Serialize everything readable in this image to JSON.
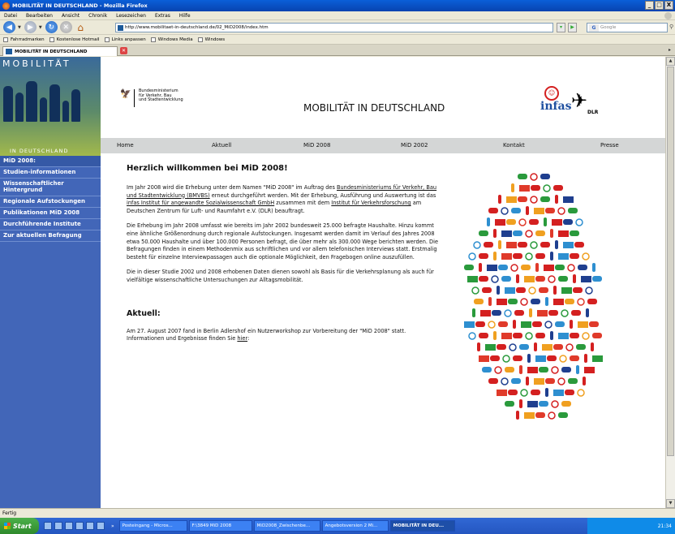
{
  "window": {
    "title": "MOBILITÄT IN DEUTSCHLAND - Mozilla Firefox",
    "buttons": [
      "_",
      "□",
      "X"
    ]
  },
  "menu": [
    "Datei",
    "Bearbeiten",
    "Ansicht",
    "Chronik",
    "Lesezeichen",
    "Extras",
    "Hilfe"
  ],
  "address": {
    "url": "http://www.mobilitaet-in-deutschland.de/02_MiD2008/index.htm",
    "search_placeholder": "Google"
  },
  "bookmarks": [
    "Fahrradmarken",
    "Kostenlose Hotmail",
    "Links anpassen",
    "Windows Media",
    "Windows"
  ],
  "tab": {
    "label": "MOBILITÄT IN DEUTSCHLAND"
  },
  "sidebar": {
    "logo_top": "MOBILITÄT",
    "logo_bottom": "IN DEUTSCHLAND",
    "items": [
      "MiD 2008:",
      "Studien-informationen",
      "Wissenschaftlicher Hintergrund",
      "Regionale Aufstockungen",
      "Publikationen MiD 2008",
      "Durchführende Institute",
      "Zur aktuellen Befragung"
    ]
  },
  "header": {
    "ministry_lines": [
      "Bundesministerium",
      "für Verkehr, Bau",
      "und Stadtentwicklung"
    ],
    "site_title": "MOBILITÄT IN DEUTSCHLAND",
    "infas": "infas",
    "dlr": "DLR"
  },
  "topnav": [
    "Home",
    "Aktuell",
    "MiD 2008",
    "MiD 2002",
    "Kontakt",
    "Presse"
  ],
  "main": {
    "heading": "Herzlich willkommen bei MiD 2008!",
    "p1_a": "Im Jahr 2008 wird die Erhebung unter dem Namen \"MiD 2008\" im Auftrag des ",
    "p1_link1": "Bundesministeriums für Verkehr, Bau und Stadtentwicklung (BMVBS)",
    "p1_b": " erneut durchgeführt werden. Mit der Erhebung, Ausführung und Auswertung ist das ",
    "p1_link2": "infas Institut für angewandte Sozialwissenschaft GmbH",
    "p1_c": " zusammen mit dem ",
    "p1_link3": "Institut für Verkehrsforschung",
    "p1_d": " am Deutschen Zentrum für Luft- und Raumfahrt e.V. (DLR) beauftragt.",
    "p2": "Die Erhebung im Jahr 2008 umfasst wie bereits im Jahr 2002 bundesweit 25.000 befragte Haushalte. Hinzu kommt eine ähnliche Größenordnung durch regionale Aufstockungen. Insgesamt werden damit im Verlauf des Jahres 2008 etwa 50.000 Haushalte und über 100.000 Personen befragt, die über mehr als 300.000 Wege berichten werden. Die Befragungen finden in einem Methodenmix aus schriftlichen und vor allem telefonischen Interviews statt. Erstmalig besteht für einzelne Interviewpassagen auch die optionale Möglichkeit, den Fragebogen online auszufüllen.",
    "p3": "Die in dieser Studie 2002 und 2008 erhobenen Daten dienen sowohl als Basis für die Verkehrsplanung als auch für vielfältige wissenschaftliche Untersuchungen zur Alltagsmobilität.",
    "heading2": "Aktuell:",
    "p4_a": "Am 27. August 2007 fand in Berlin Adlershof ein Nutzerworkshop zur Vorbereitung der \"MiD 2008\" statt. Informationen und Ergebnisse finden Sie ",
    "p4_link": "hier",
    "p4_b": ":"
  },
  "status": "Fertig",
  "taskbar": {
    "start": "Start",
    "buttons": [
      "»",
      "Posteingang - Micros...",
      "F:\\3849 MiD 2008",
      "MiD2008_Zwischenbe...",
      "Angebotsversion 2 Mi...",
      "MOBILITÄT IN DEU..."
    ],
    "clock": "21:34"
  },
  "colors": {
    "sidebar": "#4266b8",
    "topnav": "#d4d6d6",
    "accent_red": "#d42020"
  }
}
